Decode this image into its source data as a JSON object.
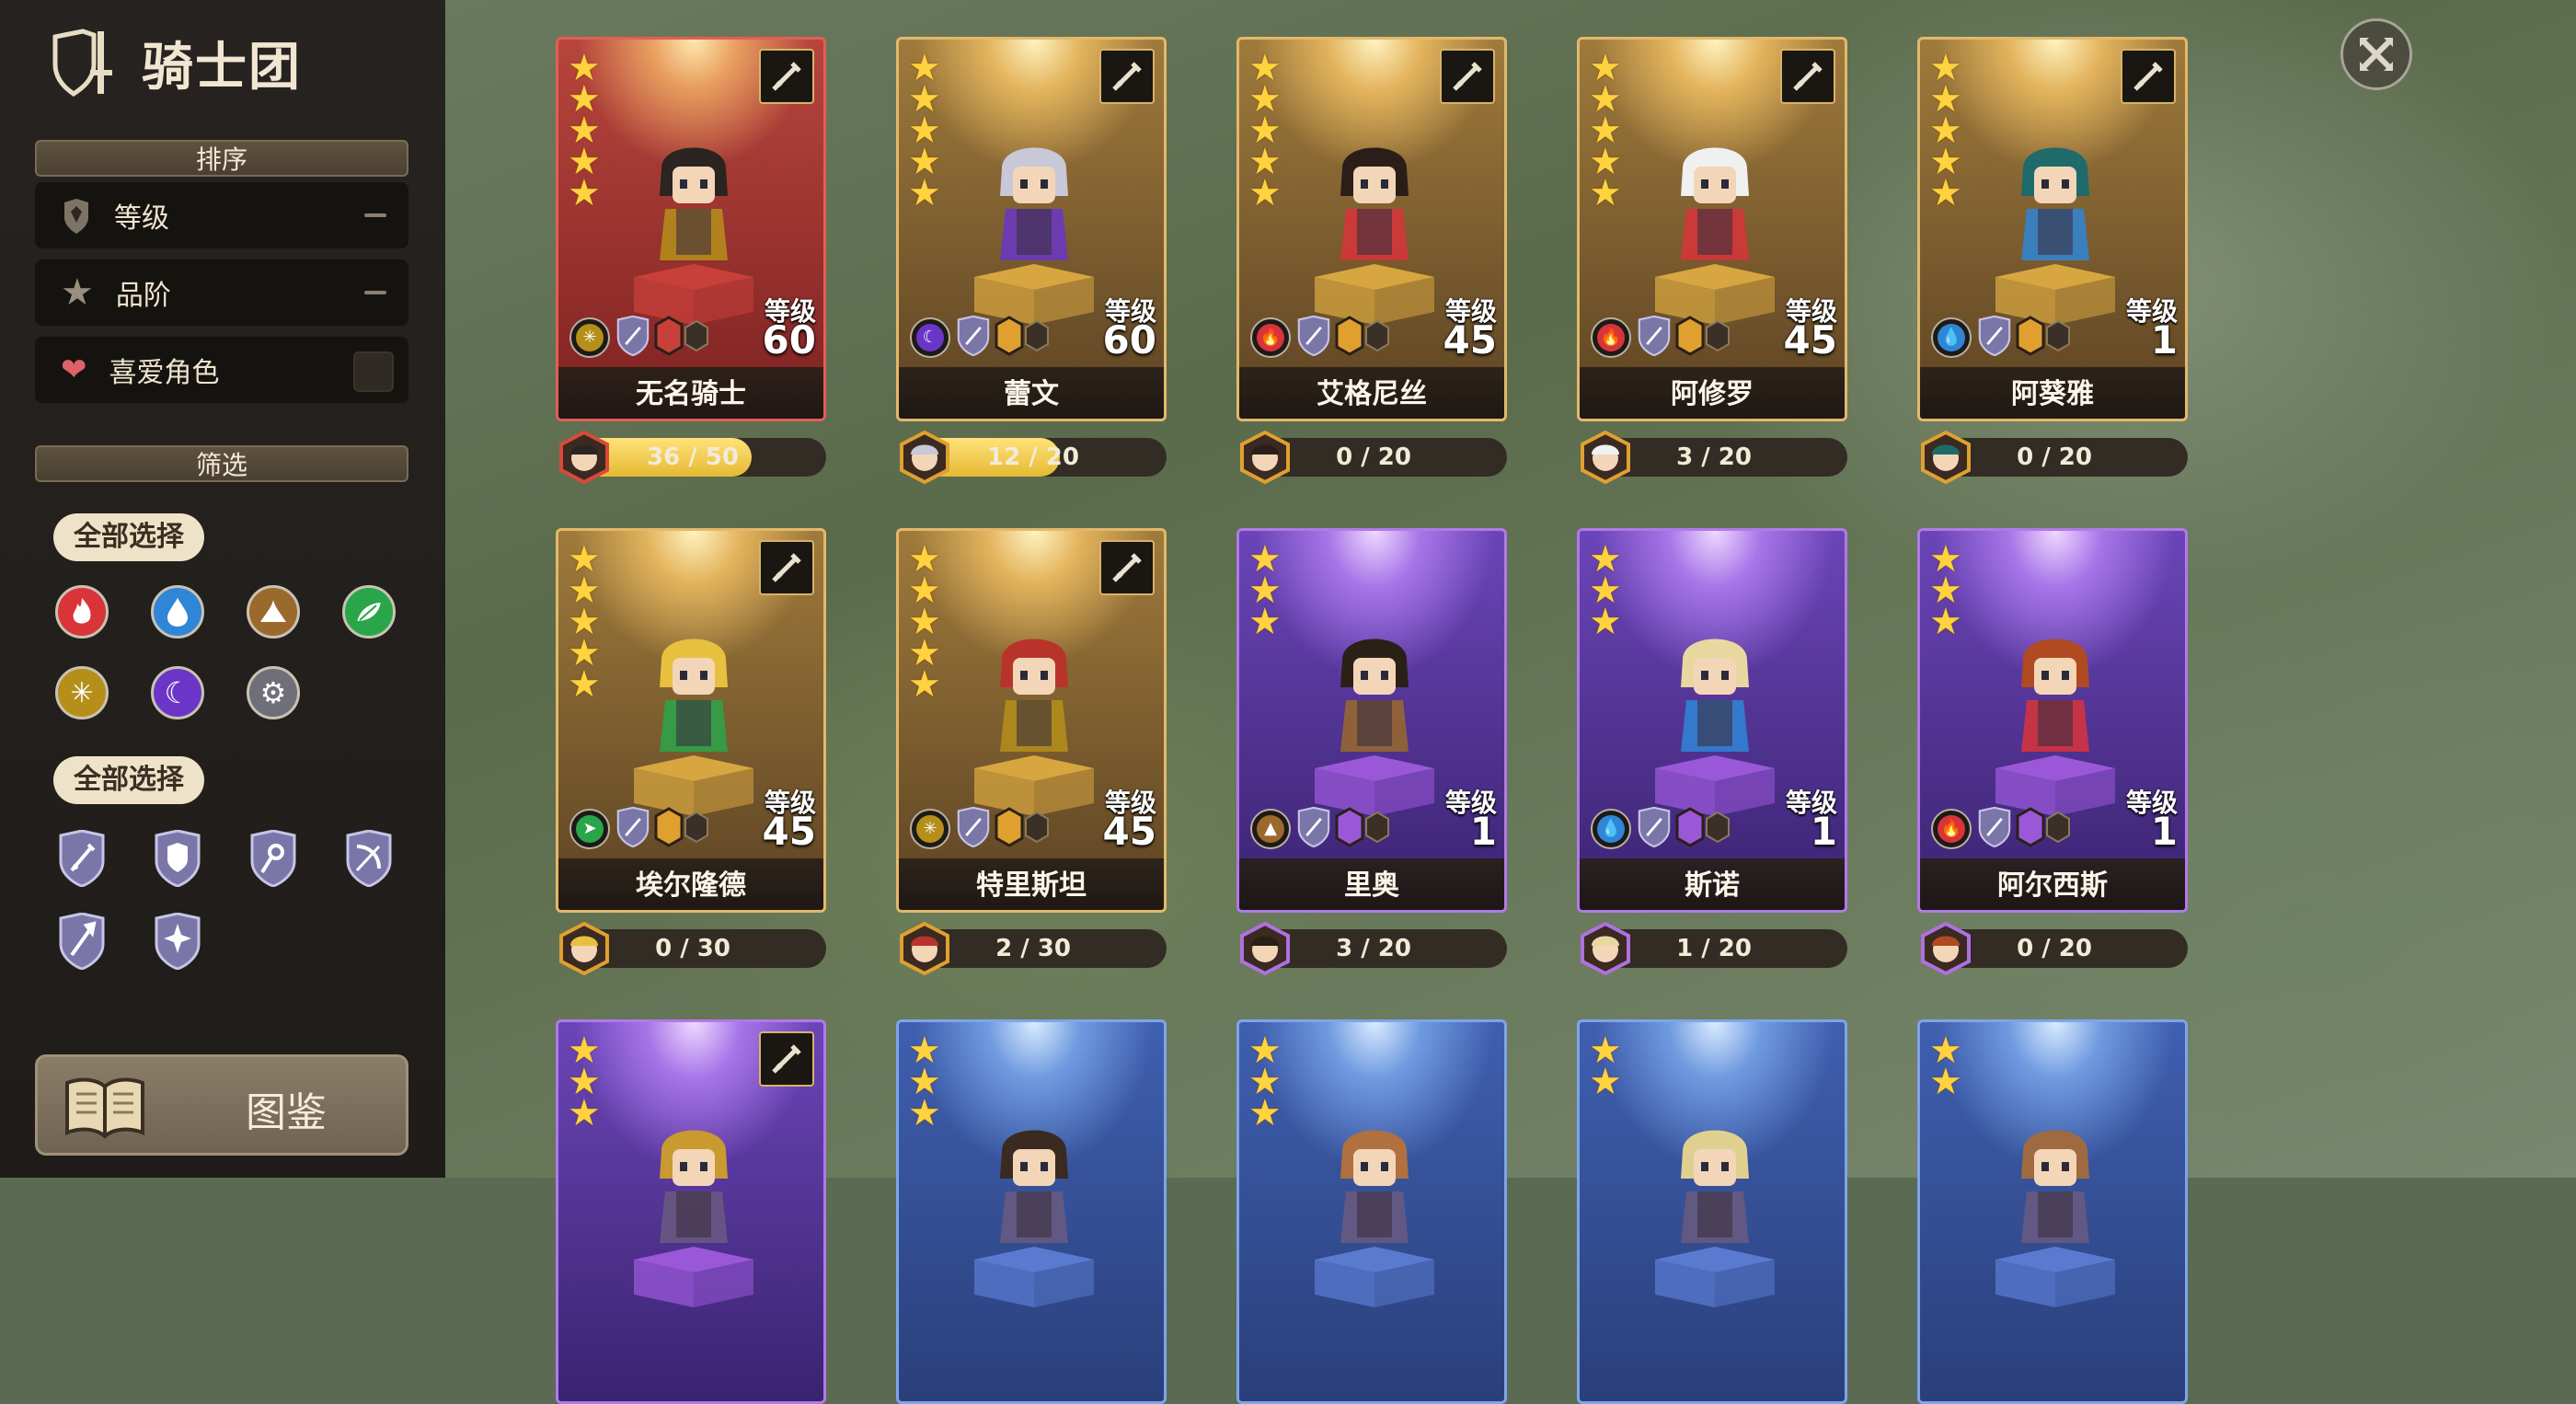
{
  "header": {
    "title": "骑士团"
  },
  "sort": {
    "header": "排序",
    "options": [
      {
        "label": "等级",
        "state": "—"
      },
      {
        "label": "品阶",
        "state": "—"
      },
      {
        "label": "喜爱角色",
        "state": "unchecked"
      }
    ]
  },
  "filter": {
    "header": "筛选",
    "select_all_elements": "全部选择",
    "elements": [
      "fire",
      "water",
      "earth",
      "wind",
      "light",
      "dark",
      "basic"
    ],
    "select_all_classes": "全部选择",
    "classes": [
      "sword",
      "shield",
      "staff",
      "bow",
      "spear",
      "support"
    ]
  },
  "codex": {
    "label": "图鉴"
  },
  "level_label": "等级",
  "heroes": [
    {
      "name": "无名骑士",
      "level": "60",
      "stars": 5,
      "frame": "red",
      "element": "light",
      "progress": "36 / 50",
      "progress_value": 0.72
    },
    {
      "name": "蕾文",
      "level": "60",
      "stars": 5,
      "frame": "gold",
      "element": "dark",
      "progress": "12 / 20",
      "progress_value": 0.6
    },
    {
      "name": "艾格尼丝",
      "level": "45",
      "stars": 5,
      "frame": "gold",
      "element": "fire",
      "progress": "0 / 20",
      "progress_value": 0
    },
    {
      "name": "阿修罗",
      "level": "45",
      "stars": 5,
      "frame": "gold",
      "element": "fire",
      "progress": "3 / 20",
      "progress_value": 0.15
    },
    {
      "name": "阿葵雅",
      "level": "1",
      "stars": 5,
      "frame": "gold",
      "element": "water",
      "progress": "0 / 20",
      "progress_value": 0
    },
    {
      "name": "埃尔隆德",
      "level": "45",
      "stars": 5,
      "frame": "gold",
      "element": "wind",
      "progress": "0 / 30",
      "progress_value": 0
    },
    {
      "name": "特里斯坦",
      "level": "45",
      "stars": 5,
      "frame": "gold",
      "element": "light",
      "progress": "2 / 30",
      "progress_value": 0.067
    },
    {
      "name": "里奥",
      "level": "1",
      "stars": 3,
      "frame": "purple",
      "element": "earth",
      "progress": "3 / 20",
      "progress_value": 0.15
    },
    {
      "name": "斯诺",
      "level": "1",
      "stars": 3,
      "frame": "purple",
      "element": "water",
      "progress": "1 / 20",
      "progress_value": 0.05
    },
    {
      "name": "阿尔西斯",
      "level": "1",
      "stars": 3,
      "frame": "purple",
      "element": "fire",
      "progress": "0 / 20",
      "progress_value": 0
    },
    {
      "name": "",
      "level": "",
      "stars": 3,
      "frame": "purple",
      "element": "",
      "progress": "",
      "progress_value": 0
    },
    {
      "name": "",
      "level": "",
      "stars": 3,
      "frame": "blue",
      "element": "",
      "progress": "",
      "progress_value": 0
    },
    {
      "name": "",
      "level": "",
      "stars": 3,
      "frame": "blue",
      "element": "",
      "progress": "",
      "progress_value": 0
    },
    {
      "name": "",
      "level": "",
      "stars": 2,
      "frame": "blue",
      "element": "",
      "progress": "",
      "progress_value": 0
    },
    {
      "name": "",
      "level": "",
      "stars": 2,
      "frame": "blue",
      "element": "",
      "progress": "",
      "progress_value": 0
    }
  ],
  "colors": {
    "fire": "#d8343a",
    "water": "#2f86d6",
    "earth": "#9a6a2c",
    "wind": "#2aa64a",
    "light": "#b58f1a",
    "dark": "#6b36c8",
    "basic": "#6f6f7a"
  }
}
